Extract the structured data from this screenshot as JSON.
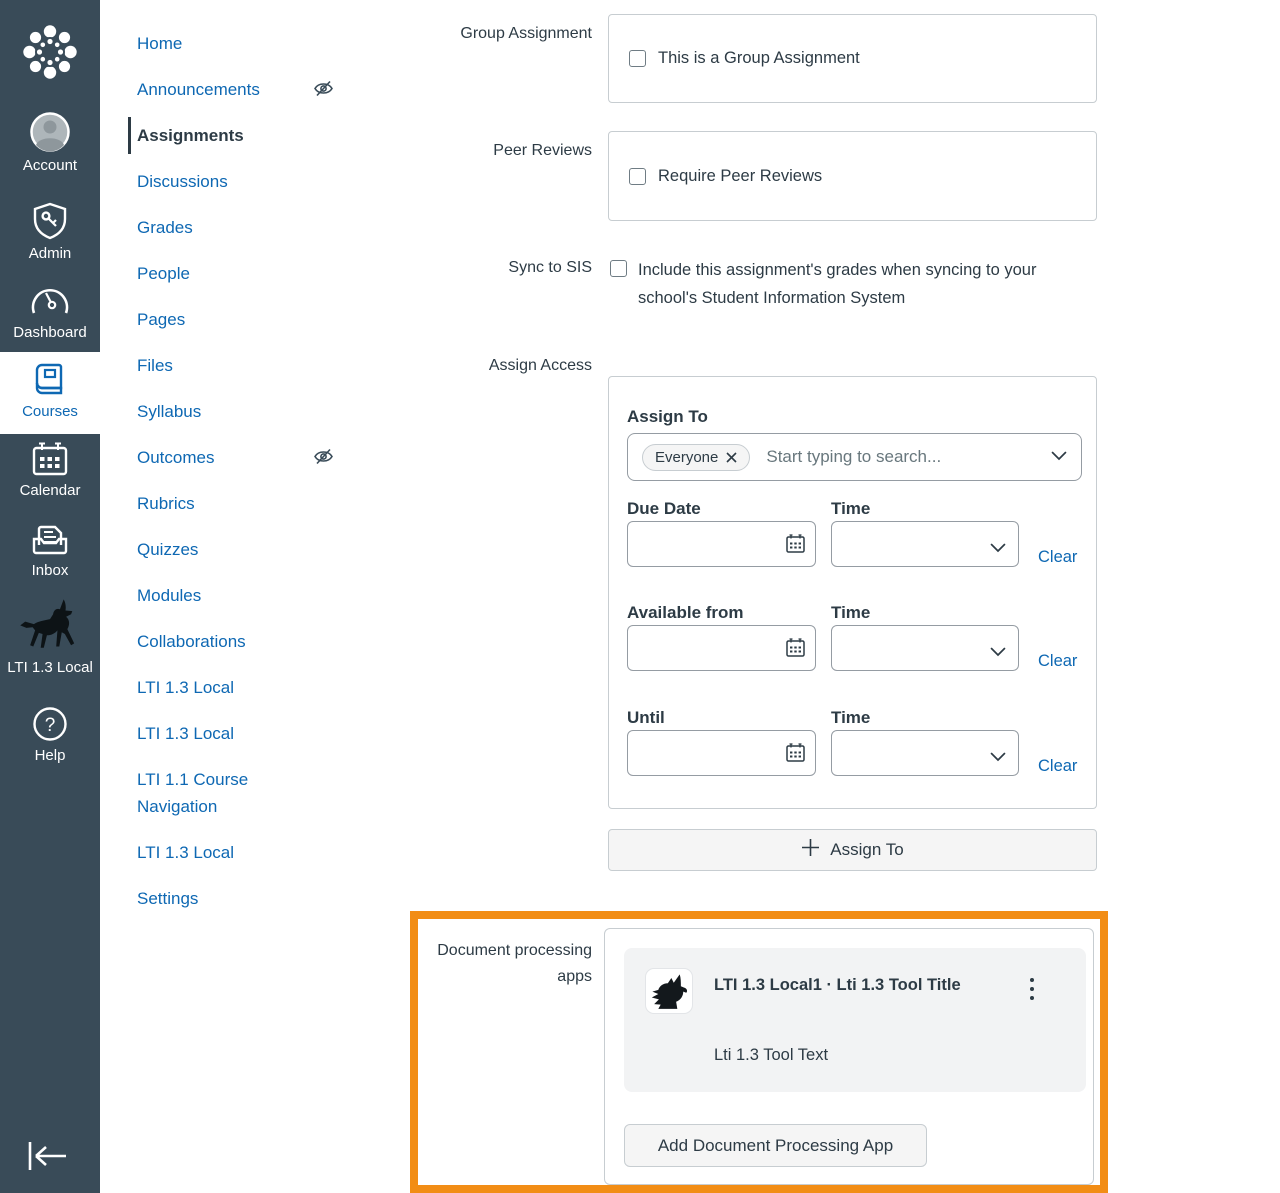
{
  "colors": {
    "sidebar_bg": "#394B58",
    "accent_blue": "#0E68B3",
    "text_dark": "#2D3B45",
    "highlight_orange": "#F28D15",
    "panel_border": "#C7CDD1",
    "card_gray": "#F2F3F4",
    "button_gray": "#F5F5F5"
  },
  "sidebar": {
    "items": [
      {
        "label": "Account"
      },
      {
        "label": "Admin"
      },
      {
        "label": "Dashboard"
      },
      {
        "label": "Courses"
      },
      {
        "label": "Calendar"
      },
      {
        "label": "Inbox"
      },
      {
        "label": "LTI 1.3 Local"
      },
      {
        "label": "Help"
      }
    ]
  },
  "course_nav": {
    "items": [
      {
        "label": "Home"
      },
      {
        "label": "Announcements",
        "hidden": true
      },
      {
        "label": "Assignments",
        "active": true
      },
      {
        "label": "Discussions"
      },
      {
        "label": "Grades"
      },
      {
        "label": "People"
      },
      {
        "label": "Pages"
      },
      {
        "label": "Files"
      },
      {
        "label": "Syllabus"
      },
      {
        "label": "Outcomes",
        "hidden": true
      },
      {
        "label": "Rubrics"
      },
      {
        "label": "Quizzes"
      },
      {
        "label": "Modules"
      },
      {
        "label": "Collaborations"
      },
      {
        "label": "LTI 1.3 Local"
      },
      {
        "label": "LTI 1.3 Local"
      },
      {
        "label": "LTI 1.1 Course Navigation"
      },
      {
        "label": "LTI 1.3 Local"
      },
      {
        "label": "Settings"
      }
    ]
  },
  "form": {
    "group_assignment": {
      "label": "Group Assignment",
      "checkbox_label": "This is a Group Assignment",
      "checked": false
    },
    "peer_reviews": {
      "label": "Peer Reviews",
      "checkbox_label": "Require Peer Reviews",
      "checked": false
    },
    "sync_to_sis": {
      "label": "Sync to SIS",
      "checkbox_label": "Include this assignment's grades when syncing to your school's Student Information System",
      "checked": false
    },
    "assign_access": {
      "label": "Assign Access",
      "assign_to_heading": "Assign To",
      "everyone_tag": "Everyone",
      "search_placeholder": "Start typing to search...",
      "rows": [
        {
          "date_label": "Due Date",
          "time_label": "Time",
          "clear_label": "Clear",
          "date_value": "",
          "time_value": ""
        },
        {
          "date_label": "Available from",
          "time_label": "Time",
          "clear_label": "Clear",
          "date_value": "",
          "time_value": ""
        },
        {
          "date_label": "Until",
          "time_label": "Time",
          "clear_label": "Clear",
          "date_value": "",
          "time_value": ""
        }
      ],
      "add_assign_to_button": "Assign To"
    },
    "document_processing": {
      "label": "Document processing apps",
      "app_title": "LTI 1.3 Local1 · Lti 1.3 Tool Title",
      "app_text": "Lti 1.3 Tool Text",
      "add_button": "Add Document Processing App"
    }
  },
  "icons": {
    "help_glyph": "?"
  }
}
